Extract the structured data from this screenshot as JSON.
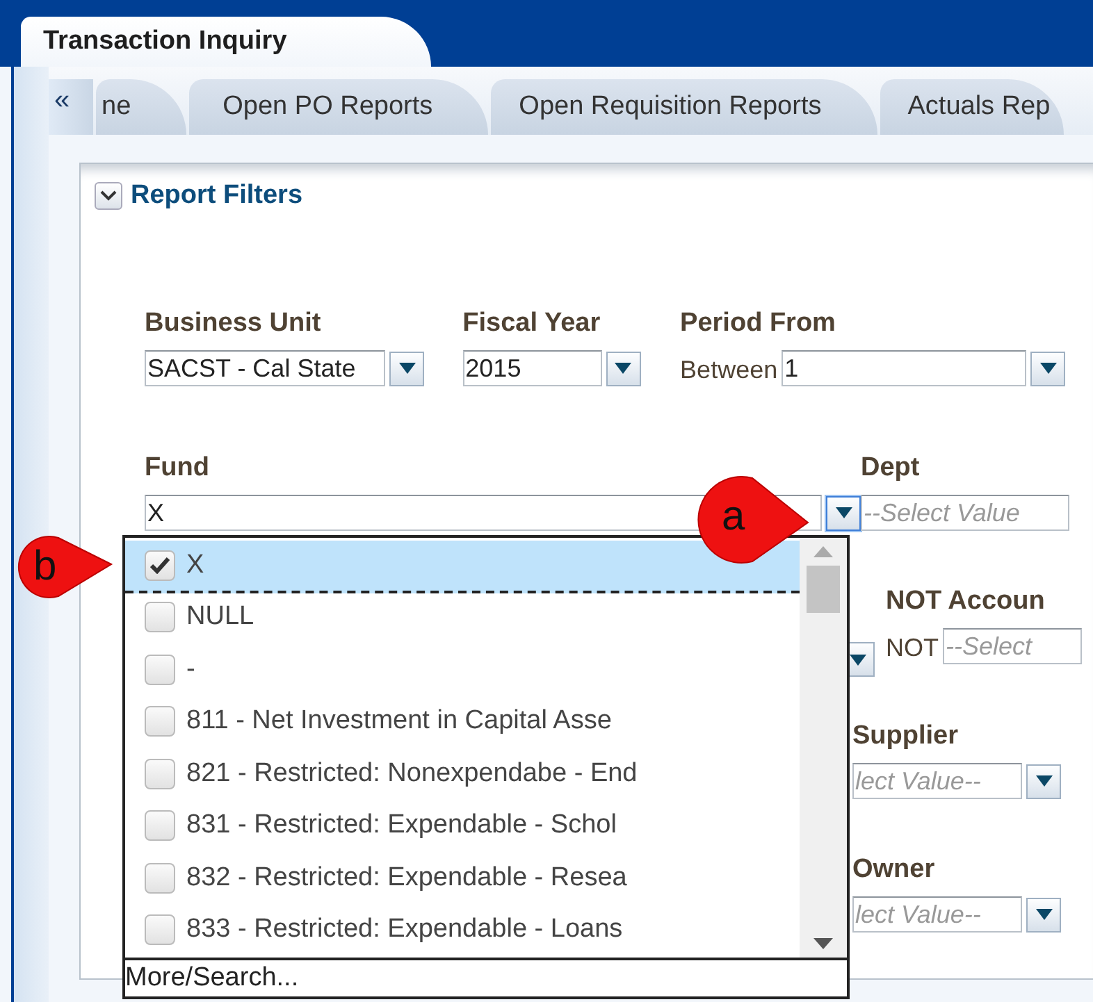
{
  "window": {
    "title": "Transaction Inquiry"
  },
  "tabs": {
    "collapse": "«",
    "items": [
      {
        "label": "ne",
        "selected": false
      },
      {
        "label": "Open PO Reports",
        "selected": false
      },
      {
        "label": "Open Requisition Reports",
        "selected": false
      },
      {
        "label": "Actuals Rep",
        "selected": false
      }
    ]
  },
  "panel": {
    "title": "Report Filters",
    "expanded": true
  },
  "filters": [
    {
      "label": "Business Unit",
      "value": "SACST - Cal State"
    },
    {
      "label": "Fiscal Year",
      "value": "2015"
    },
    {
      "label": "Period From",
      "prefix": "Between",
      "value": "1"
    }
  ],
  "fund": {
    "label": "Fund",
    "value": "X",
    "open": true
  },
  "dept": {
    "label": "Dept",
    "placeholder": "--Select Value"
  },
  "not_account": {
    "label": "NOT Accoun",
    "prefix": "NOT",
    "placeholder": "--Select"
  },
  "supplier": {
    "label": "Supplier",
    "placeholder": "lect Value--"
  },
  "owner": {
    "label": "Owner",
    "placeholder": "lect Value--"
  },
  "fund_dropdown": {
    "options": [
      {
        "label": "X",
        "checked": true,
        "selected": true
      },
      {
        "label": "NULL",
        "checked": false,
        "selected": false
      },
      {
        "label": "-",
        "checked": false,
        "selected": false
      },
      {
        "label": "811 - Net Investment in Capital Asse",
        "checked": false,
        "selected": false
      },
      {
        "label": "821 - Restricted: Nonexpendabe - End",
        "checked": false,
        "selected": false
      },
      {
        "label": "831 - Restricted: Expendable - Schol",
        "checked": false,
        "selected": false
      },
      {
        "label": "832 - Restricted: Expendable - Resea",
        "checked": false,
        "selected": false
      },
      {
        "label": "833 - Restricted: Expendable - Loans",
        "checked": false,
        "selected": false
      }
    ],
    "footer": "More/Search..."
  },
  "callouts": [
    {
      "label": "a"
    },
    {
      "label": "b"
    }
  ]
}
